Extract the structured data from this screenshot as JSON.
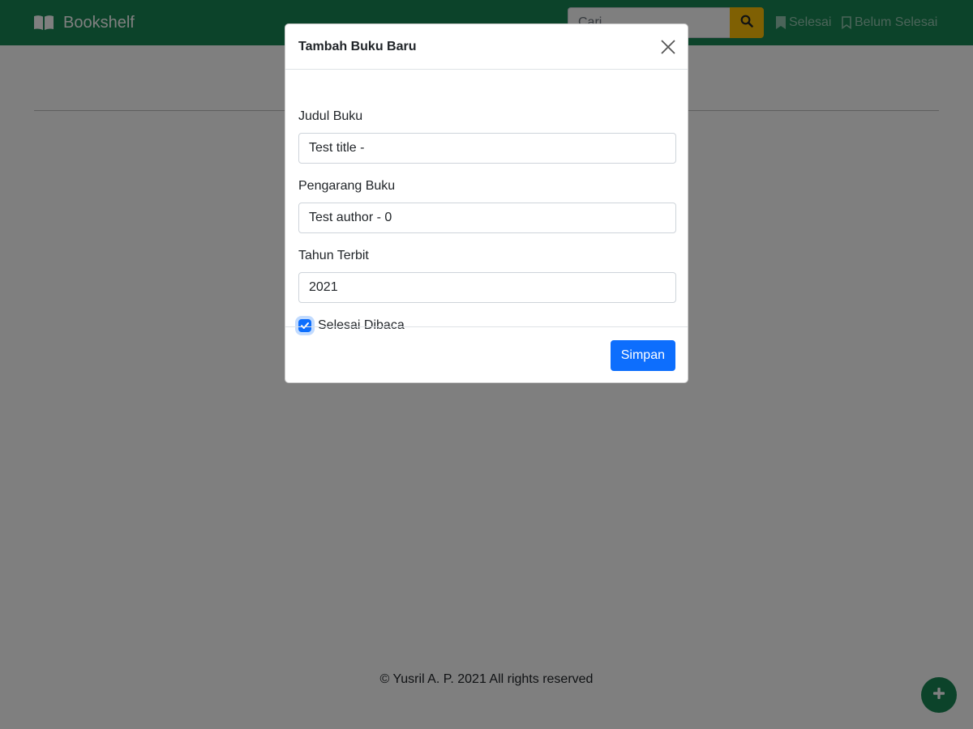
{
  "navbar": {
    "brand": "Bookshelf",
    "brand_icon": "book-open-icon",
    "search_placeholder": "Cari...",
    "search_icon": "search-icon",
    "link_done": "Selesai",
    "link_done_icon": "bookmark-fill-icon",
    "link_undone": "Belum Selesai",
    "link_undone_icon": "bookmark-outline-icon"
  },
  "footer": {
    "text": "© Yusril A. P. 2021 All rights reserved"
  },
  "fab": {
    "icon": "plus-icon"
  },
  "modal": {
    "title": "Tambah Buku Baru",
    "close_icon": "close-icon",
    "fields": {
      "title_label": "Judul Buku",
      "title_value": "Test title -",
      "author_label": "Pengarang Buku",
      "author_value": "Test author - 0",
      "year_label": "Tahun Terbit",
      "year_value": "2021"
    },
    "checkbox_label": "Selesai Dibaca",
    "checkbox_checked": true,
    "save_label": "Simpan"
  },
  "colors": {
    "navbar": "#198754",
    "search_button": "#ffc107",
    "primary": "#0d6efd",
    "fab": "#198754"
  }
}
